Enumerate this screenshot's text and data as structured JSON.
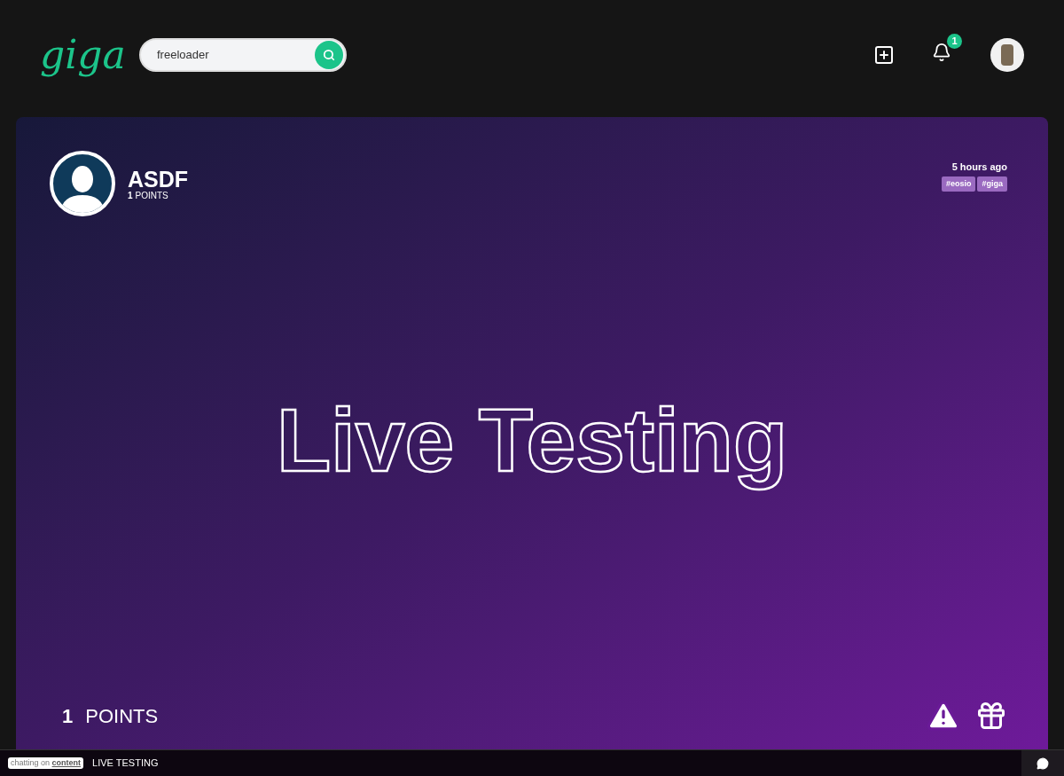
{
  "header": {
    "logo": "giga",
    "search": {
      "value": "freeloader"
    },
    "notifications": {
      "count": "1"
    }
  },
  "post": {
    "author": {
      "name": "ASDF",
      "points_value": "1",
      "points_label": "POINTS"
    },
    "time": "5 hours ago",
    "tags": [
      "#eosio",
      "#giga"
    ],
    "title": "Live Testing",
    "points": {
      "value": "1",
      "label": "POINTS"
    }
  },
  "chat_bar": {
    "prefix": "chatting on",
    "link": "content",
    "topic": "LIVE TESTING"
  }
}
